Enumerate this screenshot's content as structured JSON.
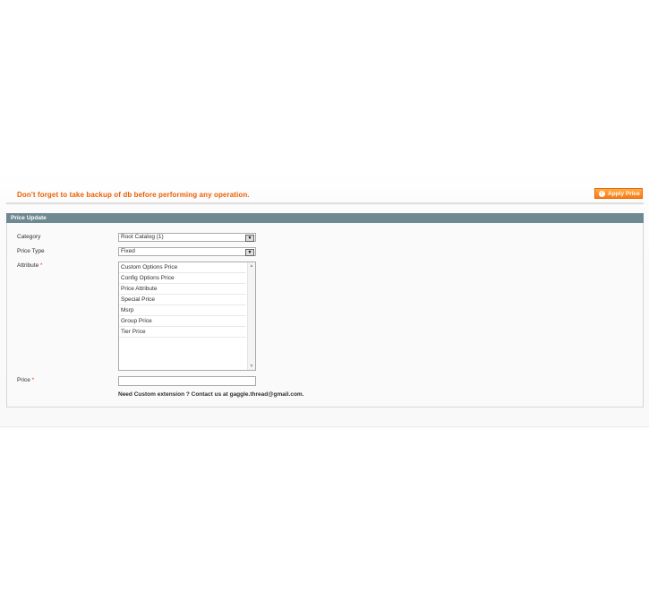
{
  "notice": "Don't forget to take backup of db before performing any operation.",
  "apply_button": {
    "label": "Apply Price",
    "icon": "check-circle-icon"
  },
  "fieldset": {
    "title": "Price Update",
    "category": {
      "label": "Category",
      "value": "Root Catalog (1)"
    },
    "price_type": {
      "label": "Price Type",
      "value": "Fixed"
    },
    "attribute": {
      "label": "Attribute",
      "required_mark": "*",
      "options": [
        "Custom Options Price",
        "Config Options Price",
        "Price Attribute",
        "Special Price",
        "Msrp",
        "Group Price",
        "Tier Price"
      ]
    },
    "price": {
      "label": "Price",
      "required_mark": "*",
      "value": ""
    },
    "contact": "Need Custom extension ? Contact us at gaggle.thread@gmail.com."
  },
  "colors": {
    "accent": "#eb5e00",
    "button": "#f77c16",
    "header_bar": "#6f8992",
    "required": "#eb340a"
  }
}
